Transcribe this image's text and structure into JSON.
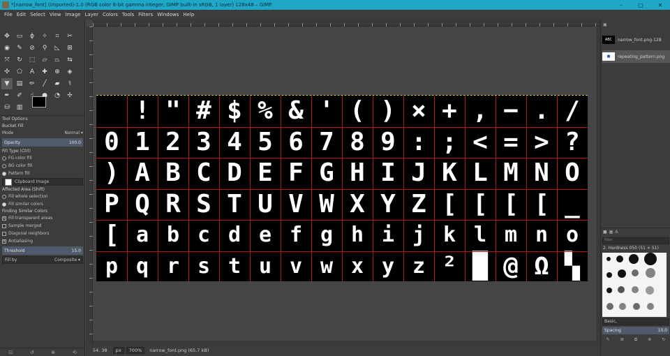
{
  "window": {
    "title": "*[narrow_font] (imported)-1.0 (RGB color 8-bit gamma integer, GIMP built-in sRGB, 1 layer) 128x48 – GIMP",
    "minimize": "–",
    "maximize": "▢",
    "close": "✕"
  },
  "menu": [
    "File",
    "Edit",
    "Select",
    "View",
    "Image",
    "Layer",
    "Colors",
    "Tools",
    "Filters",
    "Windows",
    "Help"
  ],
  "tool_options": {
    "tab_label": "Tool Options",
    "tool_name": "Bucket Fill",
    "mode_label": "Mode",
    "mode_value": "Normal",
    "opacity_label": "Opacity",
    "opacity_value": "100.0",
    "fill_type_label": "Fill Type  (Ctrl)",
    "fill_fg": "FG color fill",
    "fill_bg": "BG color fill",
    "fill_pattern": "Pattern fill",
    "pattern_name": "Clipboard Image",
    "affected_area_label": "Affected Area  (Shift)",
    "area_selection": "Fill whole selection",
    "area_similar": "Fill similar colors",
    "finding_similar_label": "Finding Similar Colors",
    "fill_transparent": "Fill transparent areas",
    "sample_merged": "Sample merged",
    "diagonal_neighbors": "Diagonal neighbors",
    "antialiasing": "Antialiasing",
    "threshold_label": "Threshold",
    "threshold_value": "15.0",
    "fill_by_label": "Fill by",
    "fill_by_value": "Composite"
  },
  "status": {
    "coords": "54, 38",
    "unit": "px",
    "zoom": "700%",
    "file_info": "narrow_font.png (65.7 kB)"
  },
  "images": [
    {
      "name": "narrow_font.png-128",
      "thumb": "ABC"
    },
    {
      "name": "repeating_pattern.png",
      "thumb": "■"
    }
  ],
  "brushes": {
    "filter_placeholder": "filter",
    "current_brush": "2. Hardness 050 (51 × 51)",
    "preset": "Basic,",
    "spacing_label": "Spacing",
    "spacing_value": "10.0"
  },
  "glyph_rows": [
    [
      " ",
      "!",
      "\"",
      "#",
      "$",
      "%",
      "&",
      "'",
      "(",
      ")",
      "×",
      "+",
      ",",
      "−",
      ".",
      "/"
    ],
    [
      "0",
      "1",
      "2",
      "3",
      "4",
      "5",
      "6",
      "7",
      "8",
      "9",
      ":",
      ";",
      "<",
      "=",
      ">",
      "?"
    ],
    [
      ")",
      "A",
      "B",
      "C",
      "D",
      "E",
      "F",
      "G",
      "H",
      "I",
      "J",
      "K",
      "L",
      "M",
      "N",
      "O"
    ],
    [
      "P",
      "Q",
      "R",
      "S",
      "T",
      "U",
      "V",
      "W",
      "X",
      "Y",
      "Z",
      "[",
      "[",
      "[",
      "[",
      "_"
    ],
    [
      "[",
      "a",
      "b",
      "c",
      "d",
      "e",
      "f",
      "g",
      "h",
      "i",
      "j",
      "k",
      "l",
      "m",
      "n",
      "o"
    ],
    [
      "p",
      "q",
      "r",
      "s",
      "t",
      "u",
      "v",
      "w",
      "x",
      "y",
      "z",
      "²",
      "█",
      "@",
      "Ω",
      "▚"
    ]
  ],
  "colors": {
    "titlebar": "#1ea7c7",
    "grid": "#b01818",
    "canvas_bg": "#000000",
    "glyph": "#ffffff"
  }
}
